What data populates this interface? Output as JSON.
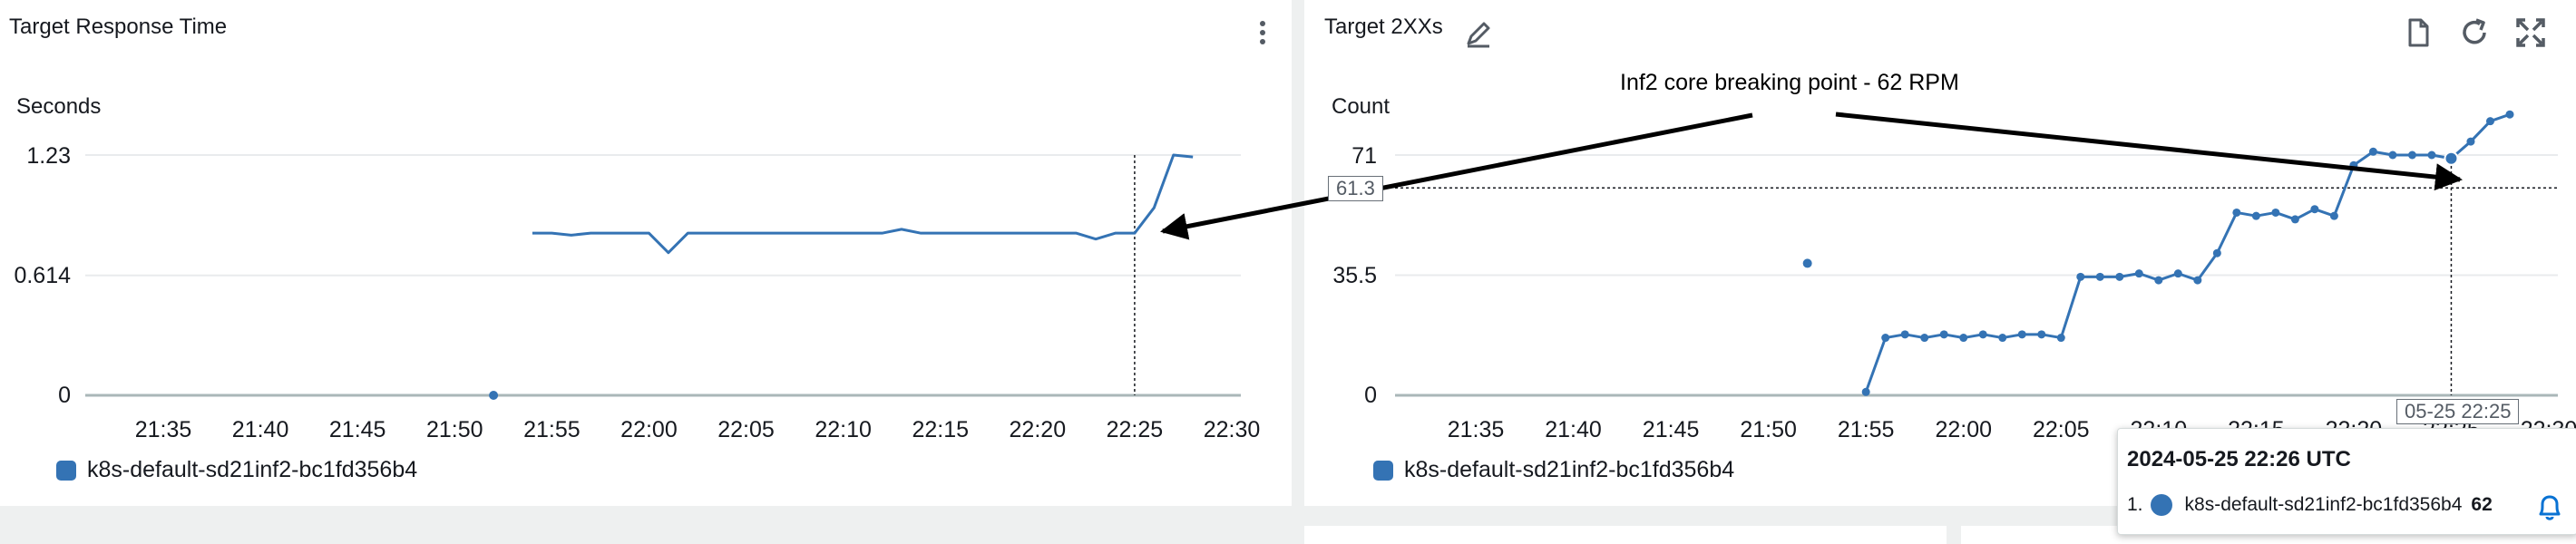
{
  "colors": {
    "series": "#3473b4",
    "axis": "#aab7b8",
    "grid": "#e9ebed",
    "text": "#16191f",
    "annotation": "#000000"
  },
  "left_panel": {
    "title": "Target Response Time",
    "menu_icon": "vertical-ellipsis-icon",
    "legend_label": "k8s-default-sd21inf2-bc1fd356b4"
  },
  "right_panel": {
    "title": "Target 2XXs",
    "edit_icon": "pencil-icon",
    "toolbar_icons": [
      "document-icon",
      "refresh-icon",
      "expand-icon"
    ],
    "legend_label": "k8s-default-sd21inf2-bc1fd356b4",
    "crosshair_value": "61.3",
    "crosshair_time": "05-25 22:25",
    "tooltip": {
      "datetime": "2024-05-25 22:26 UTC",
      "row_index": "1.",
      "series_name": "k8s-default-sd21inf2-bc1fd356b4",
      "value": "62",
      "bell_icon": "bell-icon"
    }
  },
  "annotation": {
    "text": "Inf2 core breaking point - 62 RPM"
  },
  "chart_data": [
    {
      "type": "line",
      "title": "Target Response Time",
      "ylabel": "Seconds",
      "yticks": [
        "1.23",
        "0.614",
        "0"
      ],
      "ylim": [
        0,
        1.23
      ],
      "xticks": [
        "21:35",
        "21:40",
        "21:45",
        "21:50",
        "21:55",
        "22:00",
        "22:05",
        "22:10",
        "22:15",
        "22:20",
        "22:25",
        "22:30"
      ],
      "x_range": [
        "21:31",
        "22:30"
      ],
      "crosshair": "22:25",
      "grid": true,
      "legend_placement": "bottom-left",
      "series": [
        {
          "name": "k8s-default-sd21inf2-bc1fd356b4",
          "isolated_points": [
            [
              "21:52",
              0
            ]
          ],
          "points": [
            [
              "21:54",
              0.83
            ],
            [
              "21:55",
              0.83
            ],
            [
              "21:56",
              0.82
            ],
            [
              "21:57",
              0.83
            ],
            [
              "21:58",
              0.83
            ],
            [
              "21:59",
              0.83
            ],
            [
              "22:00",
              0.83
            ],
            [
              "22:01",
              0.73
            ],
            [
              "22:02",
              0.83
            ],
            [
              "22:03",
              0.83
            ],
            [
              "22:04",
              0.83
            ],
            [
              "22:05",
              0.83
            ],
            [
              "22:06",
              0.83
            ],
            [
              "22:07",
              0.83
            ],
            [
              "22:08",
              0.83
            ],
            [
              "22:09",
              0.83
            ],
            [
              "22:10",
              0.83
            ],
            [
              "22:11",
              0.83
            ],
            [
              "22:12",
              0.83
            ],
            [
              "22:13",
              0.85
            ],
            [
              "22:14",
              0.83
            ],
            [
              "22:15",
              0.83
            ],
            [
              "22:16",
              0.83
            ],
            [
              "22:17",
              0.83
            ],
            [
              "22:18",
              0.83
            ],
            [
              "22:19",
              0.83
            ],
            [
              "22:20",
              0.83
            ],
            [
              "22:21",
              0.83
            ],
            [
              "22:22",
              0.83
            ],
            [
              "22:23",
              0.8
            ],
            [
              "22:24",
              0.83
            ],
            [
              "22:25",
              0.83
            ],
            [
              "22:26",
              0.96
            ],
            [
              "22:27",
              1.23
            ],
            [
              "22:28",
              1.22
            ]
          ]
        }
      ]
    },
    {
      "type": "line",
      "title": "Target 2XXs",
      "ylabel": "Count",
      "yticks": [
        "71",
        "35.5",
        "0"
      ],
      "ylim": [
        0,
        71
      ],
      "xticks": [
        "21:35",
        "21:40",
        "21:45",
        "21:50",
        "21:55",
        "22:00",
        "22:05",
        "22:10",
        "22:15",
        "22:20",
        "22:25",
        "22:30"
      ],
      "x_range": [
        "21:31",
        "22:30"
      ],
      "crosshair": "22:25",
      "crosshair_value": 61.3,
      "grid": true,
      "legend_placement": "bottom-left",
      "series": [
        {
          "name": "k8s-default-sd21inf2-bc1fd356b4",
          "isolated_points": [
            [
              "21:52",
              39
            ]
          ],
          "points": [
            [
              "21:55",
              1
            ],
            [
              "21:56",
              17
            ],
            [
              "21:57",
              18
            ],
            [
              "21:58",
              17
            ],
            [
              "21:59",
              18
            ],
            [
              "22:00",
              17
            ],
            [
              "22:01",
              18
            ],
            [
              "22:02",
              17
            ],
            [
              "22:03",
              18
            ],
            [
              "22:04",
              18
            ],
            [
              "22:05",
              17
            ],
            [
              "22:06",
              35
            ],
            [
              "22:07",
              35
            ],
            [
              "22:08",
              35
            ],
            [
              "22:09",
              36
            ],
            [
              "22:10",
              34
            ],
            [
              "22:11",
              36
            ],
            [
              "22:12",
              34
            ],
            [
              "22:13",
              42
            ],
            [
              "22:14",
              54
            ],
            [
              "22:15",
              53
            ],
            [
              "22:16",
              54
            ],
            [
              "22:17",
              52
            ],
            [
              "22:18",
              55
            ],
            [
              "22:19",
              53
            ],
            [
              "22:20",
              68
            ],
            [
              "22:21",
              72
            ],
            [
              "22:22",
              71
            ],
            [
              "22:23",
              71
            ],
            [
              "22:24",
              71
            ],
            [
              "22:25",
              70
            ],
            [
              "22:26",
              75
            ],
            [
              "22:27",
              81
            ],
            [
              "22:28",
              83
            ]
          ]
        }
      ]
    }
  ]
}
